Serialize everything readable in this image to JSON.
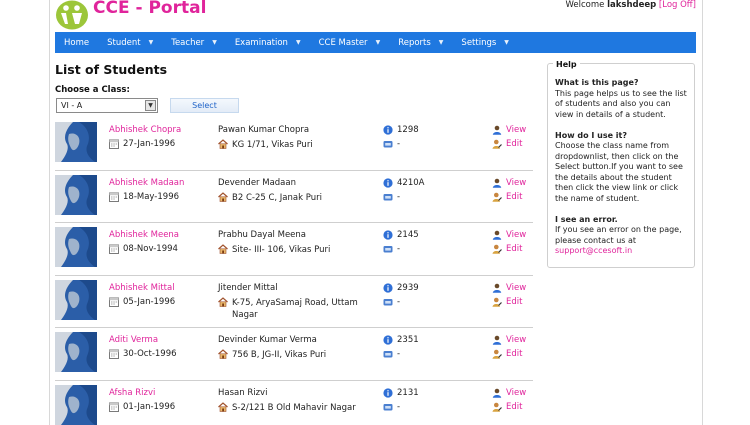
{
  "app": {
    "brand": "CCE - Portal"
  },
  "user": {
    "welcome": "Welcome",
    "name": "lakshdeep",
    "logoff": "Log Off",
    "bracket_open": "[",
    "bracket_close": "]"
  },
  "nav": [
    {
      "label": "Home",
      "dropdown": false
    },
    {
      "label": "Student",
      "dropdown": true
    },
    {
      "label": "Teacher",
      "dropdown": true
    },
    {
      "label": "Examination",
      "dropdown": true
    },
    {
      "label": "CCE Master",
      "dropdown": true
    },
    {
      "label": "Reports",
      "dropdown": true
    },
    {
      "label": "Settings",
      "dropdown": true
    }
  ],
  "page": {
    "title": "List of Students",
    "class_label": "Choose a Class:",
    "class_value": "VI - A",
    "select_button": "Select"
  },
  "students": [
    {
      "name": "Abhishek Chopra",
      "dob": "27-Jan-1996",
      "father": "Pawan Kumar Chopra",
      "address": "KG 1/71, Vikas Puri",
      "roll": "1298",
      "phone": "-"
    },
    {
      "name": "Abhishek Madaan",
      "dob": "18-May-1996",
      "father": "Devender Madaan",
      "address": "B2 C-25 C, Janak Puri",
      "roll": "4210A",
      "phone": "-"
    },
    {
      "name": "Abhishek Meena",
      "dob": "08-Nov-1994",
      "father": "Prabhu Dayal Meena",
      "address": "Site- III- 106, Vikas Puri",
      "roll": "2145",
      "phone": "-"
    },
    {
      "name": "Abhishek Mittal",
      "dob": "05-Jan-1996",
      "father": "Jitender Mittal",
      "address": "K-75, AryaSamaj Road, Uttam Nagar",
      "roll": "2939",
      "phone": "-"
    },
    {
      "name": "Aditi Verma",
      "dob": "30-Oct-1996",
      "father": "Devinder Kumar Verma",
      "address": "756 B, JG-II, Vikas Puri",
      "roll": "2351",
      "phone": "-"
    },
    {
      "name": "Afsha Rizvi",
      "dob": "01-Jan-1996",
      "father": "Hasan Rizvi",
      "address": "S-2/121 B Old Mahavir Nagar",
      "roll": "2131",
      "phone": "-"
    }
  ],
  "actions": {
    "view": "View",
    "edit": "Edit"
  },
  "help": {
    "legend": "Help",
    "q1": "What is this page?",
    "a1": "This page helps us to see the list of students and also you can view in details of a student.",
    "q2": "How do I use it?",
    "a2": "Choose the class name from dropdownlist, then click on the Select button.If you want to see the details about the student then click the view link or click the name of student.",
    "q3": "I see an error.",
    "a3": "If you see an error on the page, please contact us at",
    "email": "support@ccesoft.in"
  },
  "colors": {
    "accent": "#e0249b",
    "nav": "#1f78e0",
    "avatar": "#2b5ea8"
  }
}
